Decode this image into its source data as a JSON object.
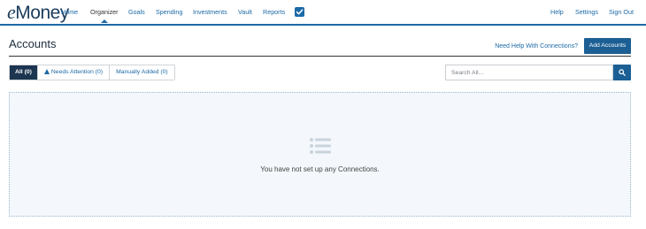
{
  "app": {
    "logo_prefix": "e",
    "logo_rest": "Money"
  },
  "nav": {
    "left": [
      {
        "label": "Home"
      },
      {
        "label": "Organizer",
        "active": true
      },
      {
        "label": "Goals"
      },
      {
        "label": "Spending"
      },
      {
        "label": "Investments"
      },
      {
        "label": "Vault"
      },
      {
        "label": "Reports"
      }
    ],
    "right": [
      {
        "label": "Help"
      },
      {
        "label": "Settings"
      },
      {
        "label": "Sign Out"
      }
    ],
    "checkbox_icon": "checkbox-checked-icon"
  },
  "header": {
    "title": "Accounts",
    "help_link": "Need Help With Connections?",
    "add_button": "Add Accounts"
  },
  "filters": {
    "tabs": [
      {
        "label": "All (0)",
        "selected": true
      },
      {
        "label": "Needs Attention (0)",
        "icon": "warning-icon"
      },
      {
        "label": "Manually Added (0)"
      }
    ]
  },
  "search": {
    "placeholder": "Search All...",
    "value": "",
    "icon": "search-icon"
  },
  "empty_state": {
    "icon": "list-icon",
    "message": "You have not set up any Connections."
  },
  "colors": {
    "brand_blue": "#1c6aa6",
    "button_blue": "#1c5f94",
    "tab_selected": "#1c3550",
    "panel_bg": "#f4f8fc"
  }
}
